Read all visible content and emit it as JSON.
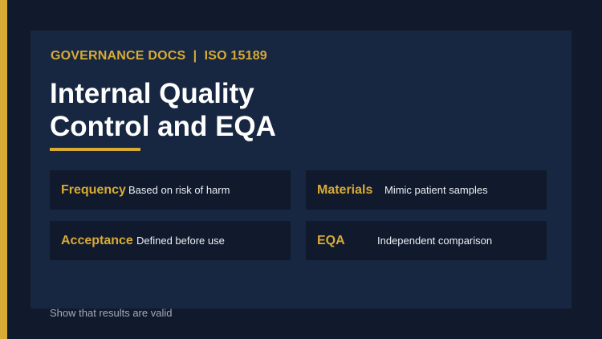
{
  "header": {
    "eyebrow": "GOVERNANCE DOCS  |  ISO 15189",
    "title_line1": "Internal Quality",
    "title_line2": "Control and EQA"
  },
  "cards": [
    {
      "term": "Frequency",
      "description": "Based on risk of harm"
    },
    {
      "term": "Materials",
      "description": "Mimic patient samples"
    },
    {
      "term": "Acceptance",
      "description": "Defined before use"
    },
    {
      "term": "EQA",
      "description": "Independent comparison"
    }
  ],
  "footer": {
    "note": "Show that results are valid"
  },
  "colors": {
    "background": "#111a2c",
    "panel": "#172741",
    "accent": "#d8ab35",
    "card": "#111a2c",
    "title": "#ffffff",
    "muted_text": "#a3abb8"
  }
}
